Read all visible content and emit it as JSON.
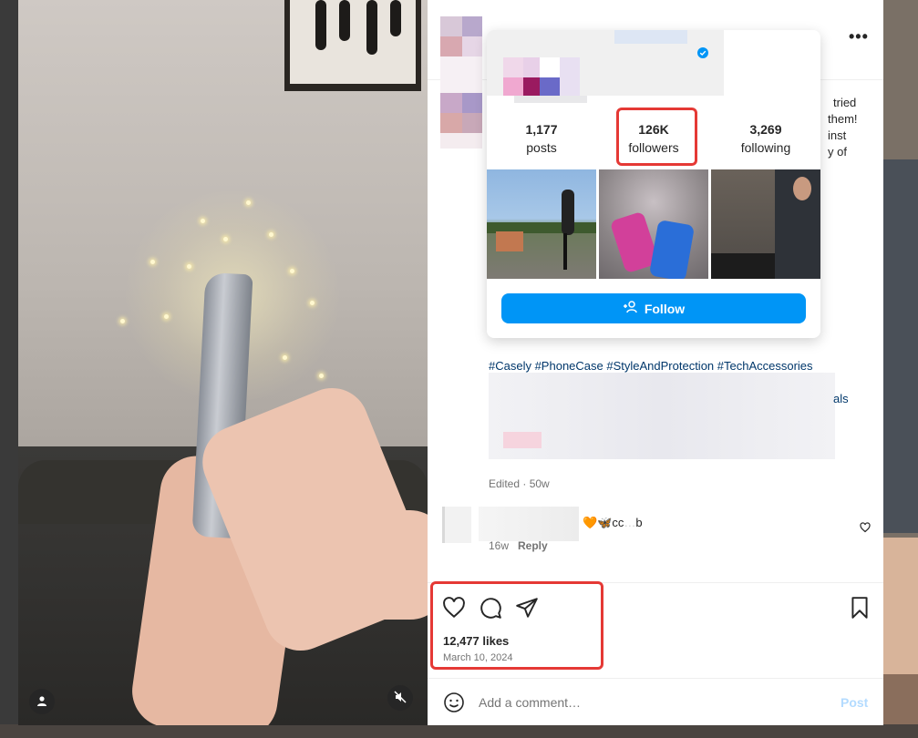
{
  "video": {
    "user_icon": "person-icon",
    "mute_icon": "muted-speaker-icon"
  },
  "caption": {
    "fragments": [
      "tried",
      "them!",
      "inst",
      "y of"
    ],
    "hashtags": "#Casely #PhoneCase #StyleAndProtection #TechAccessories",
    "trailing": "als",
    "edited": "Edited · 50w"
  },
  "comment": {
    "emoji": "🧡🦋",
    "text": "cc",
    "text_tail": "b",
    "age": "16w",
    "reply_label": "Reply"
  },
  "actions": {
    "likes": "12,477 likes",
    "date": "March 10, 2024"
  },
  "comment_bar": {
    "placeholder": "Add a comment…",
    "post_label": "Post"
  },
  "hover_card": {
    "stats": [
      {
        "value": "1,177",
        "label": "posts"
      },
      {
        "value": "126K",
        "label": "followers"
      },
      {
        "value": "3,269",
        "label": "following"
      }
    ],
    "follow_label": "Follow"
  },
  "colors": {
    "accent": "#0095f6",
    "highlight": "#e53935",
    "link": "#00376b"
  }
}
